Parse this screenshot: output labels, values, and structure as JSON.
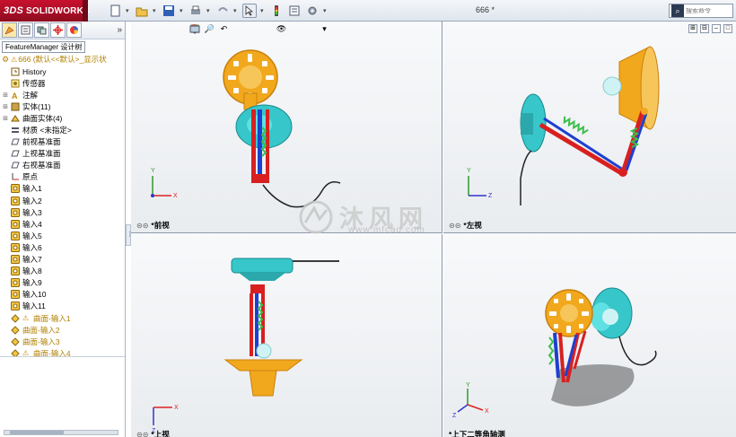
{
  "app": {
    "brand": "SOLIDWORKS",
    "brand_prefix": "3DS"
  },
  "document": {
    "title": "666 *"
  },
  "search": {
    "placeholder": "搜索命令"
  },
  "featuremanager": {
    "tab_label": "FeatureManager 设计树",
    "root": "666 (默认<<默认>_显示状",
    "items": [
      {
        "label": "History",
        "icon": "history-icon",
        "expand": ""
      },
      {
        "label": "传感器",
        "icon": "sensor-icon",
        "expand": ""
      },
      {
        "label": "注解",
        "icon": "annotation-icon",
        "expand": "+"
      },
      {
        "label": "实体(11)",
        "icon": "solid-bodies-icon",
        "expand": "+"
      },
      {
        "label": "曲面实体(4)",
        "icon": "surface-bodies-icon",
        "expand": "+"
      },
      {
        "label": "材质 <未指定>",
        "icon": "material-icon",
        "expand": ""
      },
      {
        "label": "前视基准面",
        "icon": "plane-icon",
        "expand": ""
      },
      {
        "label": "上视基准面",
        "icon": "plane-icon",
        "expand": ""
      },
      {
        "label": "右视基准面",
        "icon": "plane-icon",
        "expand": ""
      },
      {
        "label": "原点",
        "icon": "origin-icon",
        "expand": ""
      },
      {
        "label": "输入1",
        "icon": "import-icon",
        "expand": ""
      },
      {
        "label": "输入2",
        "icon": "import-icon",
        "expand": ""
      },
      {
        "label": "输入3",
        "icon": "import-icon",
        "expand": ""
      },
      {
        "label": "输入4",
        "icon": "import-icon",
        "expand": ""
      },
      {
        "label": "输入5",
        "icon": "import-icon",
        "expand": ""
      },
      {
        "label": "输入6",
        "icon": "import-icon",
        "expand": ""
      },
      {
        "label": "输入7",
        "icon": "import-icon",
        "expand": ""
      },
      {
        "label": "输入8",
        "icon": "import-icon",
        "expand": ""
      },
      {
        "label": "输入9",
        "icon": "import-icon",
        "expand": ""
      },
      {
        "label": "输入10",
        "icon": "import-icon",
        "expand": ""
      },
      {
        "label": "输入11",
        "icon": "import-icon",
        "expand": ""
      },
      {
        "label": "曲面-输入1",
        "icon": "surface-import-icon",
        "expand": "",
        "warning": true
      },
      {
        "label": "曲面-输入2",
        "icon": "surface-import-icon",
        "expand": ""
      },
      {
        "label": "曲面-输入3",
        "icon": "surface-import-icon",
        "expand": ""
      },
      {
        "label": "曲面-输入4",
        "icon": "surface-import-icon",
        "expand": "",
        "warning": true
      }
    ]
  },
  "viewports": {
    "front": "*前视",
    "left": "*左视",
    "top": "*上视",
    "iso": "*上下二等角轴测"
  },
  "watermark": {
    "title": "沐风网",
    "url": "www.mfcad.com"
  },
  "colors": {
    "brand_red": "#c8102e",
    "lamp_orange": "#f2a81d",
    "base_cyan": "#37c6c9",
    "arm_red": "#d82020",
    "arm_blue": "#1f3fd0",
    "spring_green": "#3bbf4a"
  }
}
